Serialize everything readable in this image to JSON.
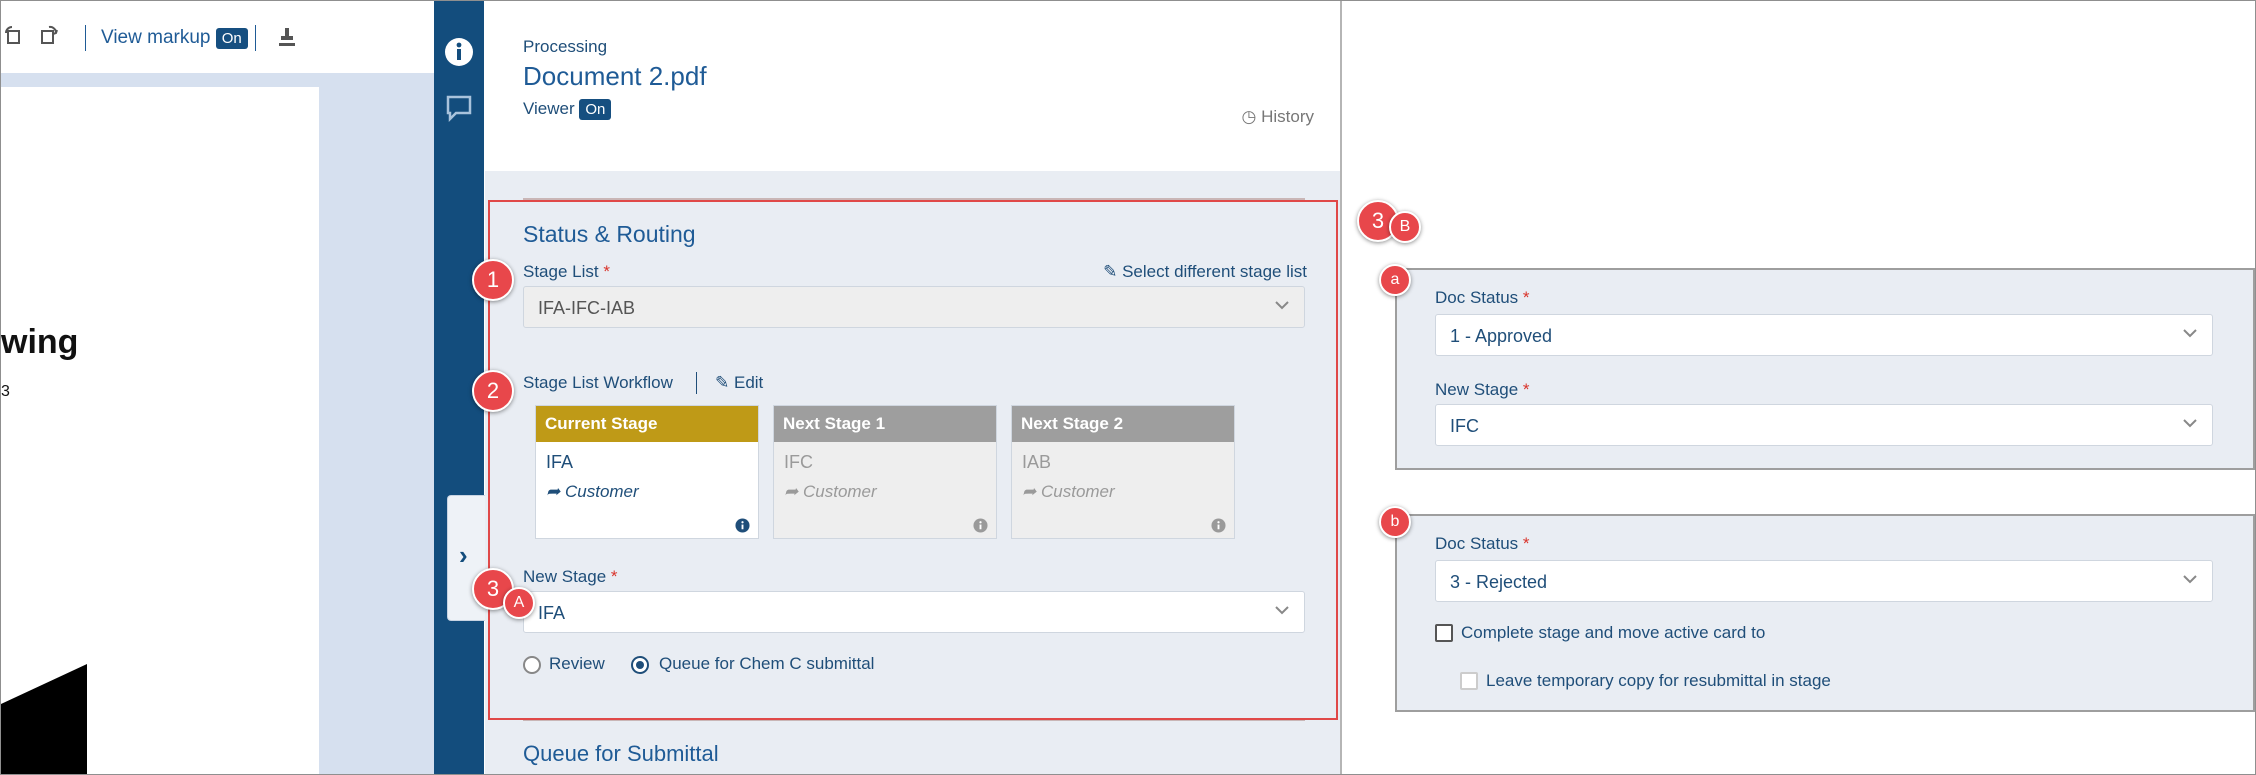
{
  "toolbar": {
    "view_markup_label": "View markup",
    "view_markup_state": "On"
  },
  "document_preview": {
    "heading_fragment": "wing",
    "small_text": "3"
  },
  "header": {
    "status_label": "Processing",
    "document_name": "Document 2.pdf",
    "viewer_label": "Viewer",
    "viewer_state": "On",
    "history_label": "History"
  },
  "status_routing": {
    "title": "Status & Routing",
    "stage_list_label": "Stage List",
    "required_mark": "*",
    "select_different_label": "Select different stage list",
    "stage_list_value": "IFA-IFC-IAB",
    "workflow_label": "Stage List Workflow",
    "edit_label": "Edit",
    "stages": [
      {
        "header": "Current Stage",
        "name": "IFA",
        "assignee": "Customer"
      },
      {
        "header": "Next Stage 1",
        "name": "IFC",
        "assignee": "Customer"
      },
      {
        "header": "Next Stage 2",
        "name": "IAB",
        "assignee": "Customer"
      }
    ],
    "new_stage_label": "New Stage",
    "new_stage_value": "IFA",
    "radio_review": "Review",
    "radio_queue": "Queue for Chem C submittal",
    "selected_radio": "Queue for Chem C submittal"
  },
  "queue_section": {
    "title": "Queue for Submittal"
  },
  "callouts": {
    "c1": "1",
    "c2": "2",
    "c3": "3",
    "c3_sub": "A",
    "c3b": "3",
    "c3b_sub": "B",
    "a": "a",
    "b": "b"
  },
  "option_a": {
    "doc_status_label": "Doc Status",
    "doc_status_value": "1 - Approved",
    "new_stage_label": "New Stage",
    "new_stage_value": "IFC"
  },
  "option_b": {
    "doc_status_label": "Doc Status",
    "doc_status_value": "3 - Rejected",
    "complete_stage_label": "Complete stage and move active card to",
    "leave_copy_label": "Leave temporary copy for resubmittal in stage"
  },
  "colors": {
    "brand_dark": "#134d7d",
    "accent_text": "#1f5b96",
    "current_stage": "#bf9a17",
    "next_stage": "#9e9e9e",
    "callout_red": "#e8474b",
    "highlight_border": "#e04848",
    "required": "#d9342b"
  },
  "icons": {
    "toolbar": [
      "rotate-left-icon",
      "rotate-right-icon",
      "stamp-icon"
    ],
    "rail": [
      "info-icon",
      "comment-icon"
    ],
    "misc": [
      "chevron-right-icon",
      "history-clock-icon",
      "pencil-icon",
      "share-arrow-icon",
      "info-icon",
      "chevron-down-icon"
    ]
  }
}
